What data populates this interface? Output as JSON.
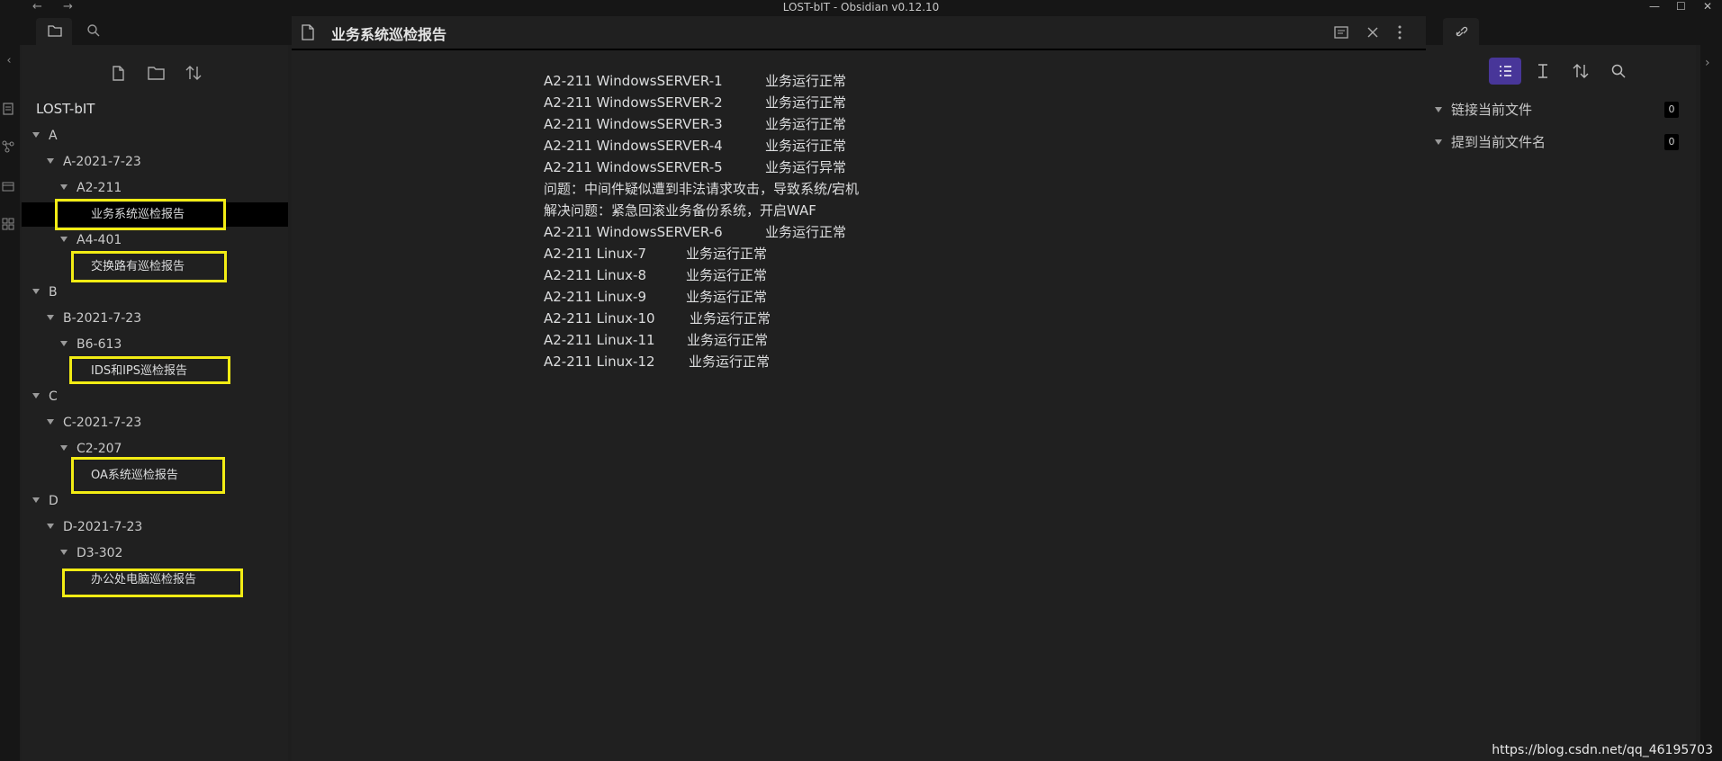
{
  "app": {
    "title": "LOST-bIT - Obsidian v0.12.10",
    "nav_back": "←",
    "nav_forward": "→",
    "minimize": "—",
    "maximize": "☐",
    "close": "✕"
  },
  "left_sidebar": {
    "vault_name": "LOST-bIT",
    "tree": [
      {
        "label": "A"
      },
      {
        "label": "A-2021-7-23"
      },
      {
        "label": "A2-211"
      },
      {
        "label": "业务系统巡检报告"
      },
      {
        "label": "A4-401"
      },
      {
        "label": "交换路有巡检报告"
      },
      {
        "label": "B"
      },
      {
        "label": "B-2021-7-23"
      },
      {
        "label": "B6-613"
      },
      {
        "label": "IDS和IPS巡检报告"
      },
      {
        "label": "C"
      },
      {
        "label": "C-2021-7-23"
      },
      {
        "label": "C2-207"
      },
      {
        "label": "OA系统巡检报告"
      },
      {
        "label": "D"
      },
      {
        "label": "D-2021-7-23"
      },
      {
        "label": "D3-302"
      },
      {
        "label": "办公处电脑巡检报告"
      }
    ]
  },
  "editor": {
    "title": "业务系统巡检报告",
    "lines": [
      {
        "a": "A2-211 WindowsSERVER-1",
        "b": "业务运行正常"
      },
      {
        "a": "A2-211 WindowsSERVER-2",
        "b": "业务运行正常"
      },
      {
        "a": "A2-211 WindowsSERVER-3",
        "b": "业务运行正常"
      },
      {
        "a": "A2-211 WindowsSERVER-4",
        "b": "业务运行正常"
      },
      {
        "a": "A2-211 WindowsSERVER-5",
        "b": "业务运行异常"
      },
      {
        "a": "问题：中间件疑似遭到非法请求攻击，导致系统/宕机",
        "b": ""
      },
      {
        "a": "解决问题：紧急回滚业务备份系统，开启WAF",
        "b": ""
      },
      {
        "a": "A2-211 WindowsSERVER-6",
        "b": "业务运行正常"
      },
      {
        "a": "A2-211 Linux-7",
        "b": "业务运行正常"
      },
      {
        "a": "A2-211 Linux-8",
        "b": "业务运行正常"
      },
      {
        "a": "A2-211 Linux-9",
        "b": "业务运行正常"
      },
      {
        "a": "A2-211 Linux-10",
        "b": "业务运行正常"
      },
      {
        "a": "A2-211 Linux-11",
        "b": "业务运行正常"
      },
      {
        "a": "A2-211 Linux-12",
        "b": "业务运行正常"
      }
    ]
  },
  "right_sidebar": {
    "backlinks_label": "链接当前文件",
    "backlinks_count": "0",
    "unlinked_label": "提到当前文件名",
    "unlinked_count": "0"
  },
  "watermark": "https://blog.csdn.net/qq_46195703"
}
